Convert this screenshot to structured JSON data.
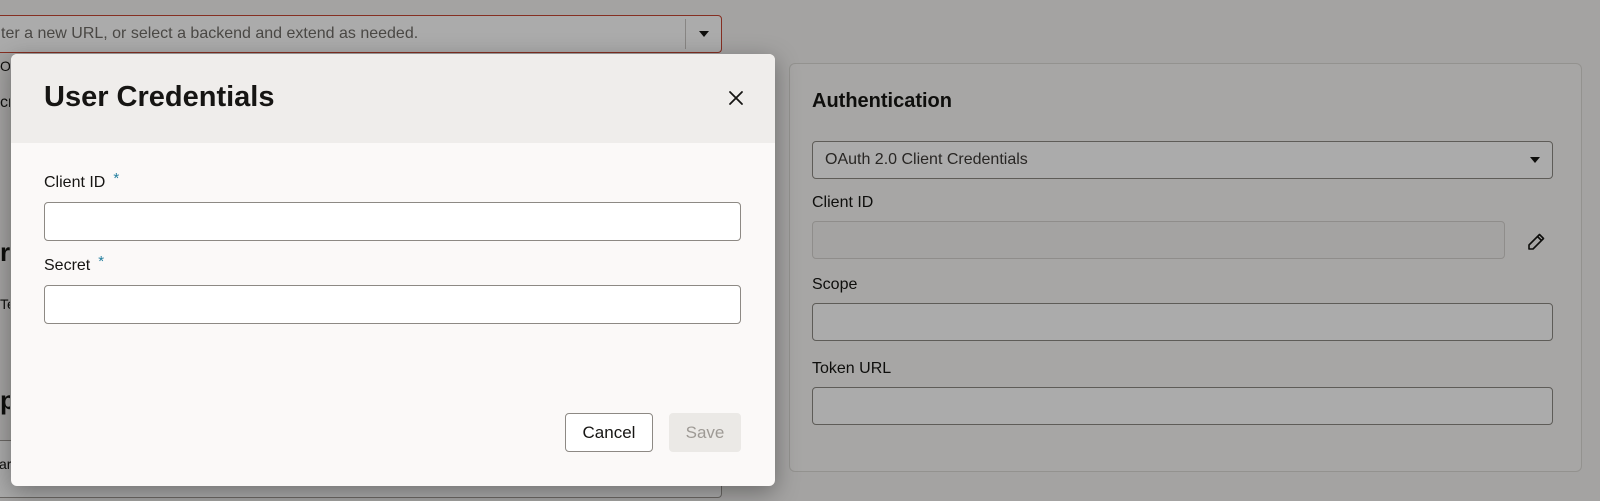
{
  "background": {
    "url_combo": {
      "placeholder": "ter a new URL, or select a backend and extend as needed."
    },
    "fragments": {
      "f1": "Or",
      "f2": "cr",
      "f3": "rv",
      "f4": "Te",
      "f5": "p",
      "f6": "ar"
    },
    "auth_panel": {
      "title": "Authentication",
      "type_select": {
        "value": "OAuth 2.0 Client Credentials"
      },
      "client_id_label": "Client ID",
      "scope_label": "Scope",
      "token_url_label": "Token URL"
    }
  },
  "dialog": {
    "title": "User Credentials",
    "fields": {
      "client_id": {
        "label": "Client ID",
        "required_mark": "*",
        "value": ""
      },
      "secret": {
        "label": "Secret",
        "required_mark": "*",
        "value": ""
      }
    },
    "buttons": {
      "cancel": "Cancel",
      "save": "Save"
    }
  },
  "icons": {
    "close": "close-icon",
    "dropdown": "chevron-down-icon",
    "edit": "pencil-icon"
  },
  "colors": {
    "required_asterisk": "#227e9e",
    "error_border": "#c74634",
    "overlay": "rgba(0,0,0,0.33)"
  }
}
